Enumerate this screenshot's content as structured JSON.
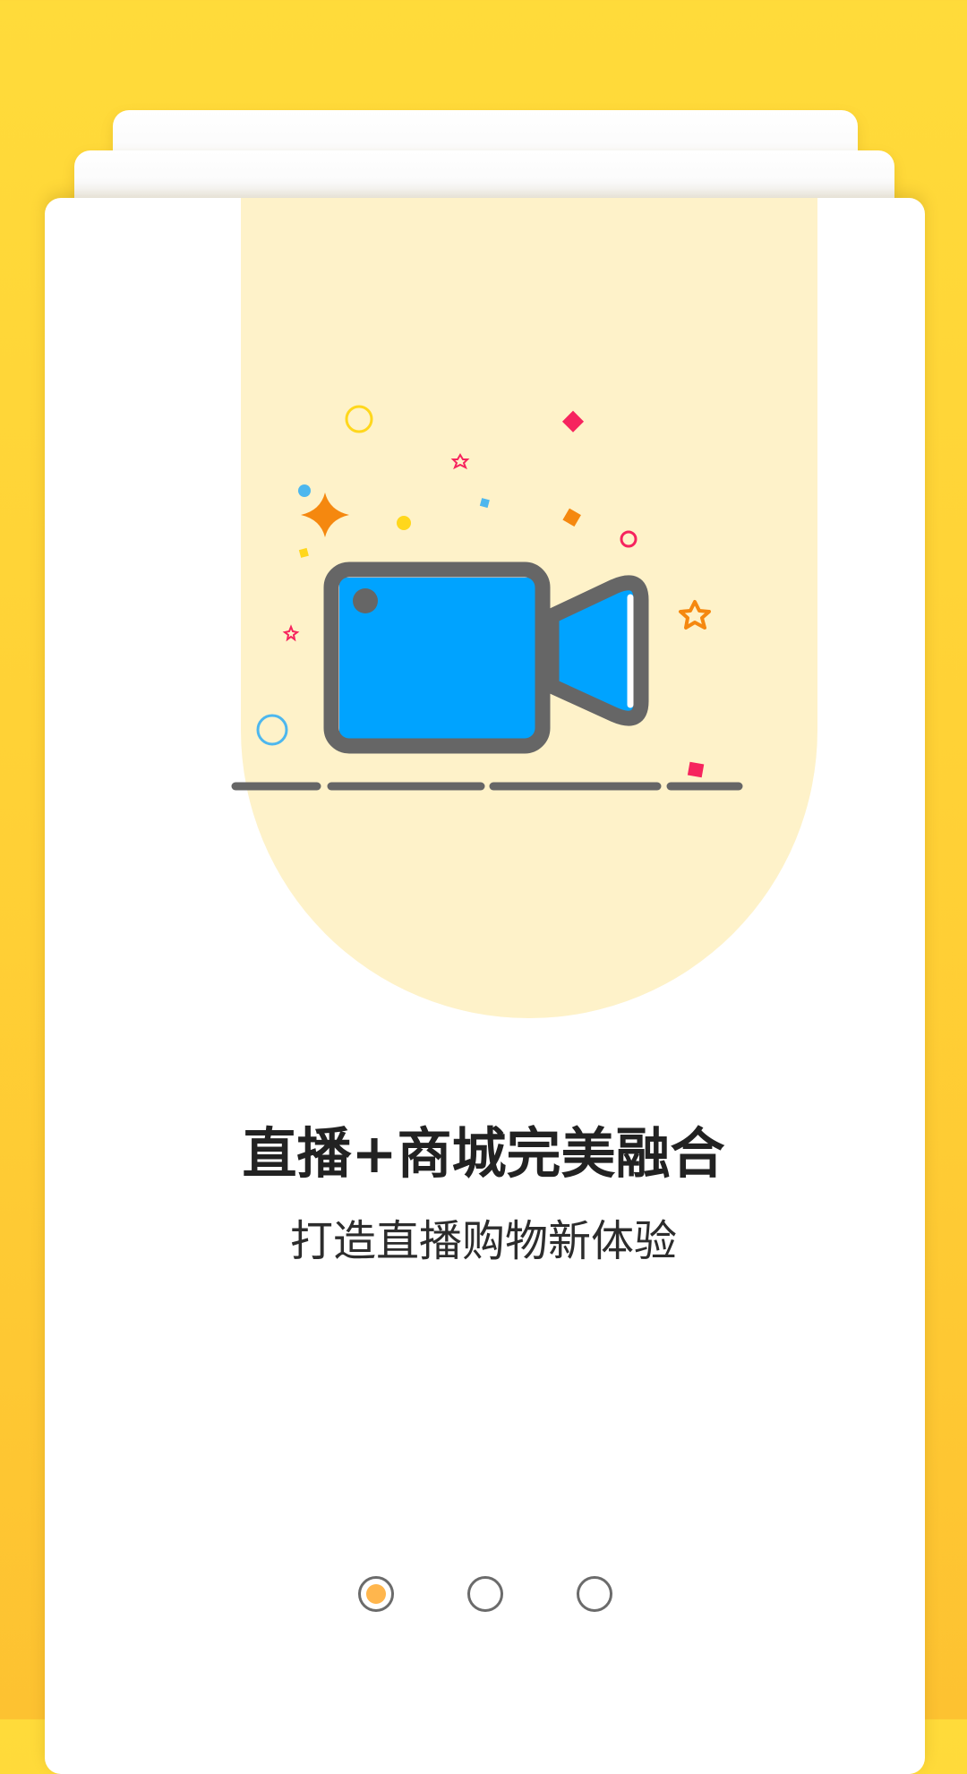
{
  "onboarding": {
    "title": "直播+商城完美融合",
    "subtitle": "打造直播购物新体验"
  },
  "pager": {
    "pages": [
      {
        "label": "page 1",
        "active": true
      },
      {
        "label": "page 2",
        "active": false
      },
      {
        "label": "page 3",
        "active": false
      }
    ],
    "active_index": 0
  },
  "colors": {
    "background": "#FFD33A",
    "banner": "#FEF2C9",
    "camera_body": "#00A3FF",
    "outline": "#666666",
    "active_dot": "#FFB64D",
    "accent_orange": "#F5880F",
    "accent_pink": "#F6245E",
    "accent_yellow": "#FFD71C",
    "accent_blue": "#4DB7EE"
  },
  "icons": {
    "hero": "video-camera-icon"
  }
}
